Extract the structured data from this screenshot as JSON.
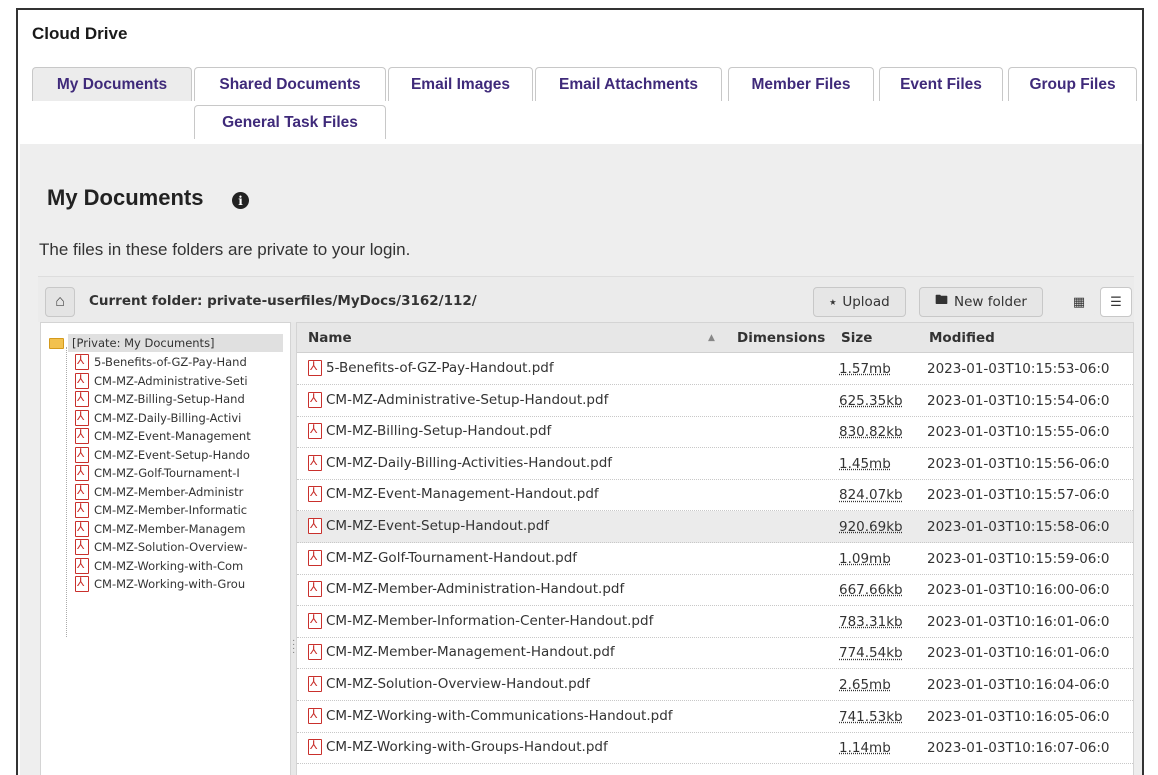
{
  "app": {
    "title": "Cloud Drive"
  },
  "tabs": [
    {
      "label": "My Documents",
      "active": true
    },
    {
      "label": "Shared Documents",
      "active": false
    },
    {
      "label": "Email Images",
      "active": false
    },
    {
      "label": "Email Attachments",
      "active": false
    },
    {
      "label": "Member Files",
      "active": false
    },
    {
      "label": "Event Files",
      "active": false
    },
    {
      "label": "Group Files",
      "active": false
    },
    {
      "label": "General Task Files",
      "active": false
    }
  ],
  "page": {
    "title": "My Documents",
    "info_icon": "info-icon",
    "subtitle": "The files in these folders are private to your login."
  },
  "toolbar": {
    "home_icon": "home-icon",
    "current_folder_label": "Current folder: private-userfiles/MyDocs/3162/112/",
    "upload_label": "Upload",
    "new_folder_label": "New folder",
    "grid_view_icon": "grid-view-icon",
    "list_view_icon": "list-view-icon"
  },
  "tree": {
    "root_label": "[Private: My Documents]",
    "items": [
      "5-Benefits-of-GZ-Pay-Hand",
      "CM-MZ-Administrative-Seti",
      "CM-MZ-Billing-Setup-Hand",
      "CM-MZ-Daily-Billing-Activi",
      "CM-MZ-Event-Management",
      "CM-MZ-Event-Setup-Hando",
      "CM-MZ-Golf-Tournament-I",
      "CM-MZ-Member-Administr",
      "CM-MZ-Member-Informatic",
      "CM-MZ-Member-Managem",
      "CM-MZ-Solution-Overview-",
      "CM-MZ-Working-with-Com",
      "CM-MZ-Working-with-Grou"
    ]
  },
  "grid": {
    "columns": {
      "name": "Name",
      "dimensions": "Dimensions",
      "size": "Size",
      "modified": "Modified"
    },
    "sort_indicator": "▲",
    "rows": [
      {
        "name": "5-Benefits-of-GZ-Pay-Handout.pdf",
        "size": "1.57mb",
        "modified": "2023-01-03T10:15:53-06:0",
        "selected": false
      },
      {
        "name": "CM-MZ-Administrative-Setup-Handout.pdf",
        "size": "625.35kb",
        "modified": "2023-01-03T10:15:54-06:0",
        "selected": false
      },
      {
        "name": "CM-MZ-Billing-Setup-Handout.pdf",
        "size": "830.82kb",
        "modified": "2023-01-03T10:15:55-06:0",
        "selected": false
      },
      {
        "name": "CM-MZ-Daily-Billing-Activities-Handout.pdf",
        "size": "1.45mb",
        "modified": "2023-01-03T10:15:56-06:0",
        "selected": false
      },
      {
        "name": "CM-MZ-Event-Management-Handout.pdf",
        "size": "824.07kb",
        "modified": "2023-01-03T10:15:57-06:0",
        "selected": false
      },
      {
        "name": "CM-MZ-Event-Setup-Handout.pdf",
        "size": "920.69kb",
        "modified": "2023-01-03T10:15:58-06:0",
        "selected": true
      },
      {
        "name": "CM-MZ-Golf-Tournament-Handout.pdf",
        "size": "1.09mb",
        "modified": "2023-01-03T10:15:59-06:0",
        "selected": false
      },
      {
        "name": "CM-MZ-Member-Administration-Handout.pdf",
        "size": "667.66kb",
        "modified": "2023-01-03T10:16:00-06:0",
        "selected": false
      },
      {
        "name": "CM-MZ-Member-Information-Center-Handout.pdf",
        "size": "783.31kb",
        "modified": "2023-01-03T10:16:01-06:0",
        "selected": false
      },
      {
        "name": "CM-MZ-Member-Management-Handout.pdf",
        "size": "774.54kb",
        "modified": "2023-01-03T10:16:01-06:0",
        "selected": false
      },
      {
        "name": "CM-MZ-Solution-Overview-Handout.pdf",
        "size": "2.65mb",
        "modified": "2023-01-03T10:16:04-06:0",
        "selected": false
      },
      {
        "name": "CM-MZ-Working-with-Communications-Handout.pdf",
        "size": "741.53kb",
        "modified": "2023-01-03T10:16:05-06:0",
        "selected": false
      },
      {
        "name": "CM-MZ-Working-with-Groups-Handout.pdf",
        "size": "1.14mb",
        "modified": "2023-01-03T10:16:07-06:0",
        "selected": false
      }
    ]
  },
  "colors": {
    "tab_text": "#3f2a7a",
    "content_bg": "#eeeeee",
    "pdf_red": "#c9302c",
    "folder_yellow": "#f2c14e"
  }
}
